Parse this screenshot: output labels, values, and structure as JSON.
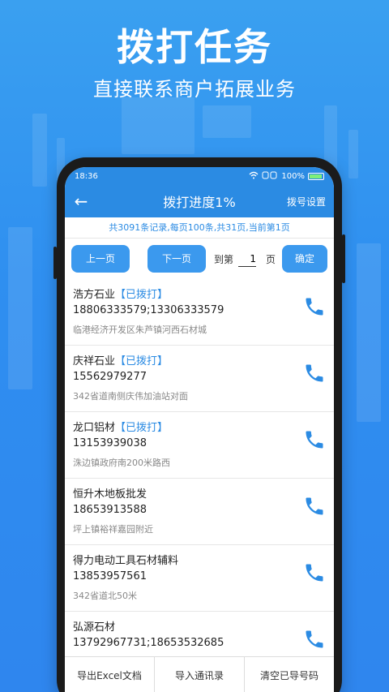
{
  "promo": {
    "title": "拨打任务",
    "subtitle": "直接联系商户拓展业务"
  },
  "status_bar": {
    "time": "18:36",
    "battery": "100%"
  },
  "app_bar": {
    "back_icon": "arrow-left-icon",
    "title": "拨打进度1%",
    "action": "拨号设置"
  },
  "summary": "共3091条记录,每页100条,共31页,当前第1页",
  "pager": {
    "prev": "上一页",
    "next": "下一页",
    "goto_prefix": "到第",
    "page_value": "1",
    "goto_suffix": "页",
    "confirm": "确定"
  },
  "items": [
    {
      "name": "浩方石业",
      "tag": "【已拨打】",
      "phone": "18806333579;13306333579",
      "address": "临港经济开发区朱芦镇河西石材城"
    },
    {
      "name": "庆祥石业",
      "tag": "【已拨打】",
      "phone": "15562979277",
      "address": "342省道南侧庆伟加油站对面"
    },
    {
      "name": "龙口铝材",
      "tag": "【已拨打】",
      "phone": "13153939038",
      "address": "洙边镇政府南200米路西"
    },
    {
      "name": "恒升木地板批发",
      "tag": "",
      "phone": "18653913588",
      "address": "坪上镇裕祥嘉园附近"
    },
    {
      "name": "得力电动工具石材辅料",
      "tag": "",
      "phone": "13853957561",
      "address": "342省道北50米"
    },
    {
      "name": "弘源石材",
      "tag": "",
      "phone": "13792967731;18653532685",
      "address": ""
    }
  ],
  "bottom_bar": {
    "export": "导出Excel文档",
    "import": "导入通讯录",
    "clear": "清空已导号码"
  },
  "colors": {
    "accent": "#2b8be3",
    "call_icon": "#2b8be3"
  }
}
